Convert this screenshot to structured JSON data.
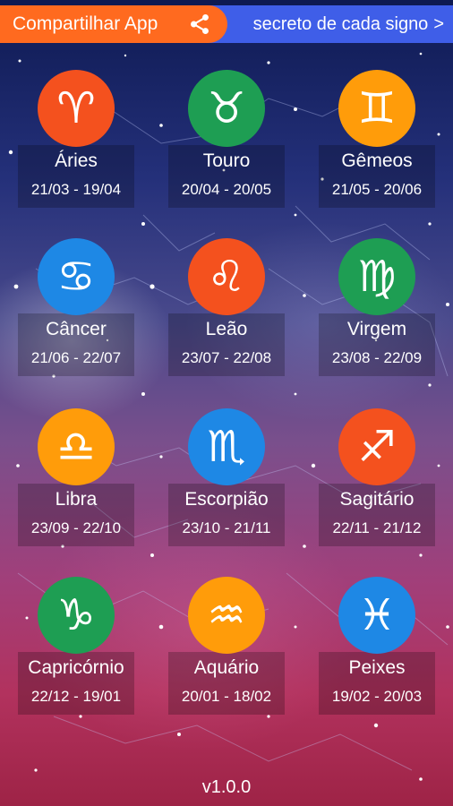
{
  "banner": {
    "text": "secreto de cada signo",
    "chevron": ">"
  },
  "share": {
    "label": "Compartilhar App"
  },
  "signs": [
    {
      "name": "Áries",
      "dates": "21/03 - 19/04",
      "symbol": "♈",
      "color": "#f4511e"
    },
    {
      "name": "Touro",
      "dates": "20/04 - 20/05",
      "symbol": "♉",
      "color": "#1e9e53"
    },
    {
      "name": "Gêmeos",
      "dates": "21/05 - 20/06",
      "symbol": "♊",
      "color": "#ff9c0a"
    },
    {
      "name": "Câncer",
      "dates": "21/06 - 22/07",
      "symbol": "♋",
      "color": "#1e88e5"
    },
    {
      "name": "Leão",
      "dates": "23/07 - 22/08",
      "symbol": "♌",
      "color": "#f4511e"
    },
    {
      "name": "Virgem",
      "dates": "23/08 - 22/09",
      "symbol": "♍",
      "color": "#1e9e53"
    },
    {
      "name": "Libra",
      "dates": "23/09 - 22/10",
      "symbol": "♎",
      "color": "#ff9c0a"
    },
    {
      "name": "Escorpião",
      "dates": "23/10 - 21/11",
      "symbol": "♏",
      "color": "#1e88e5"
    },
    {
      "name": "Sagitário",
      "dates": "22/11 - 21/12",
      "symbol": "♐",
      "color": "#f4511e"
    },
    {
      "name": "Capricórnio",
      "dates": "22/12 - 19/01",
      "symbol": "♑",
      "color": "#1e9e53"
    },
    {
      "name": "Aquário",
      "dates": "20/01 - 18/02",
      "symbol": "♒",
      "color": "#ff9c0a"
    },
    {
      "name": "Peixes",
      "dates": "19/02 - 20/03",
      "symbol": "♓",
      "color": "#1e88e5"
    }
  ],
  "version": "v1.0.0"
}
